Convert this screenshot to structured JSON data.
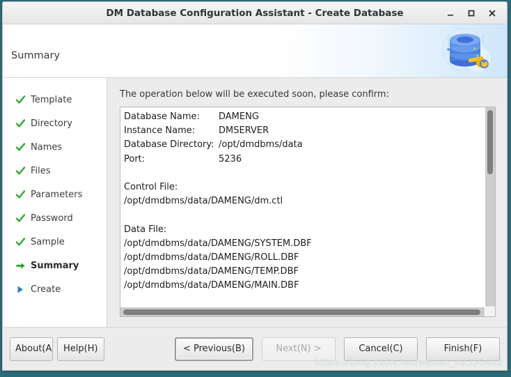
{
  "window": {
    "title": "DM Database Configuration Assistant - Create Database",
    "minimize_label": "minimize",
    "maximize_label": "maximize",
    "close_label": "close"
  },
  "banner": {
    "title": "Summary",
    "art_name": "database-wrench-illustration"
  },
  "sidebar": {
    "items": [
      {
        "label": "Template",
        "state": "done"
      },
      {
        "label": "Directory",
        "state": "done"
      },
      {
        "label": "Names",
        "state": "done"
      },
      {
        "label": "Files",
        "state": "done"
      },
      {
        "label": "Parameters",
        "state": "done"
      },
      {
        "label": "Password",
        "state": "done"
      },
      {
        "label": "Sample",
        "state": "done"
      },
      {
        "label": "Summary",
        "state": "current"
      },
      {
        "label": "Create",
        "state": "pending"
      }
    ]
  },
  "main": {
    "prompt": "The operation below will be executed soon, please confirm:",
    "summary": {
      "fields": [
        {
          "key": "Database Name:",
          "value": "DAMENG"
        },
        {
          "key": "Instance Name:",
          "value": "DMSERVER"
        },
        {
          "key": "Database Directory:",
          "value": "/opt/dmdbms/data"
        },
        {
          "key": "Port:",
          "value": "5236"
        }
      ],
      "control_file_heading": "Control File:",
      "control_files": [
        "/opt/dmdbms/data/DAMENG/dm.ctl"
      ],
      "data_file_heading": "Data File:",
      "data_files": [
        "/opt/dmdbms/data/DAMENG/SYSTEM.DBF",
        "/opt/dmdbms/data/DAMENG/ROLL.DBF",
        "/opt/dmdbms/data/DAMENG/TEMP.DBF",
        "/opt/dmdbms/data/DAMENG/MAIN.DBF"
      ]
    }
  },
  "footer": {
    "about": "About(A)",
    "help": "Help(H)",
    "previous": "< Previous(B)",
    "next": "Next(N) >",
    "cancel": "Cancel(C)",
    "finish": "Finish(F)"
  },
  "watermark": "https://blog.csdn.net/weixin_42356462",
  "colors": {
    "check": "#2fa82f",
    "arrow_current": "#27a327",
    "arrow_pending": "#2c7fd6",
    "accent_blue": "#4a7fe0",
    "wrench_yellow": "#f5c518"
  }
}
